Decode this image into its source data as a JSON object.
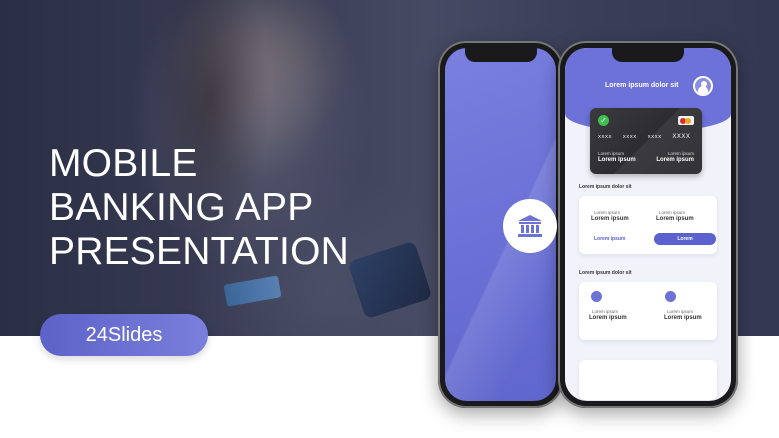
{
  "slide": {
    "title_lines": [
      "MOBILE",
      "BANKING APP",
      "PRESENTATION"
    ],
    "brand": "24Slides"
  },
  "colors": {
    "accent": "#6c72d8",
    "button": "#5b61cf",
    "card_dark": "#333337",
    "success": "#3fbf4f"
  },
  "phone_left": {
    "icon": "bank-icon"
  },
  "phone_right": {
    "header_title": "Lorem ipsum dolor sit",
    "avatar_icon": "user-avatar-icon",
    "card": {
      "check_icon": "check-icon",
      "brand_icon": "mastercard-icon",
      "number_groups": [
        "XXXX",
        "XXXX",
        "XXXX",
        "XXXX"
      ],
      "left_label": "Lorem ipsum",
      "left_value": "Lorem ipsum",
      "right_label": "Lorem ipsum",
      "right_value": "Lorem ipsum"
    },
    "section1": {
      "label": "Lorem ipsum dolor sit",
      "col1_label": "Lorem ipsum",
      "col1_value": "Lorem ipsum",
      "col2_label": "Lorem ipsum",
      "col2_value": "Lorem ipsum",
      "link": "Lorem ipsum",
      "button": "Lorem"
    },
    "section2": {
      "label": "Lorem ipsum dolor sit",
      "col1_label": "Lorem ipsum",
      "col1_value": "Lorem ipsum",
      "col2_label": "Lorem ipsum",
      "col2_value": "Lorem ipsum"
    }
  }
}
